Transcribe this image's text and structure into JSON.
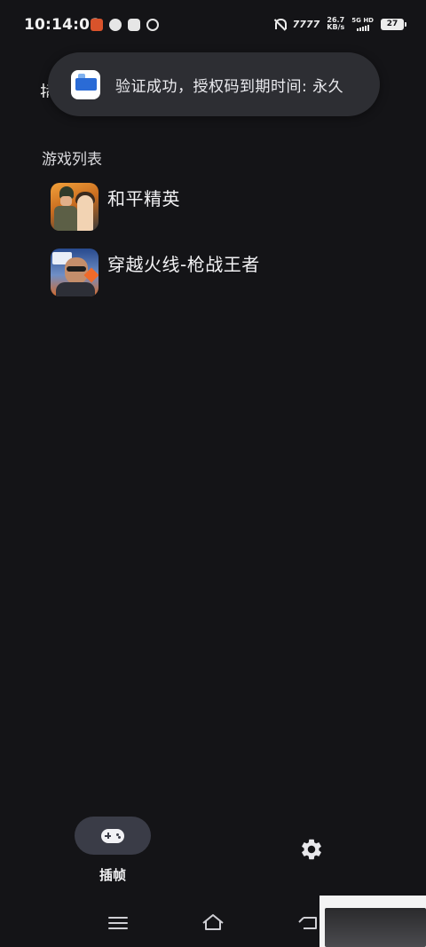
{
  "status_bar": {
    "time": "10:14:08",
    "signal_label": "7777",
    "net_speed_value": "26.7",
    "net_speed_unit": "KB/s",
    "network_type": "5G HD",
    "battery": "27"
  },
  "toast": {
    "message": "验证成功，授权码到期时间: 永久"
  },
  "partial_title": "插",
  "game_list": {
    "section_title": "游戏列表",
    "games": [
      {
        "name": "和平精英"
      },
      {
        "name": "穿越火线-枪战王者"
      }
    ]
  },
  "bottom_tab": {
    "label": "插帧"
  },
  "icons": {
    "tab": "gamepad-icon",
    "settings": "gear-icon",
    "nav_menu": "menu-icon",
    "nav_home": "home-icon",
    "nav_back": "back-icon"
  },
  "colors": {
    "background": "#141417",
    "toast_bg": "#2d2e33",
    "tab_active_bg": "#3a3c47"
  }
}
